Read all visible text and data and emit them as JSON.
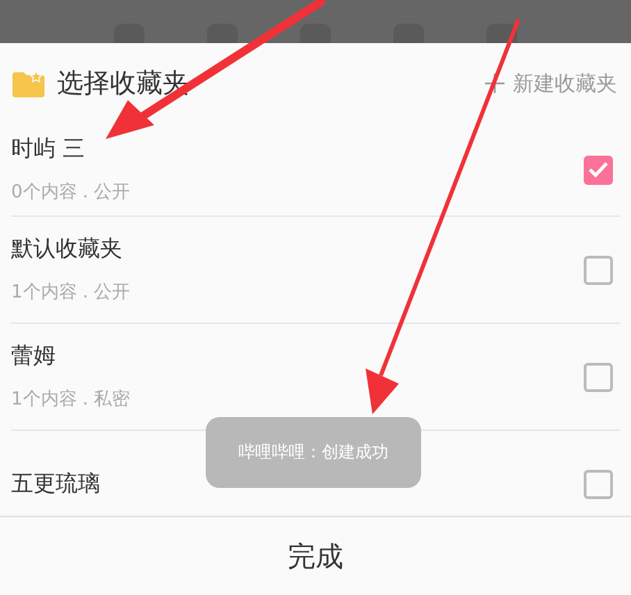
{
  "header": {
    "title": "选择收藏夹",
    "new_folder": "新建收藏夹"
  },
  "folders": [
    {
      "name": "时屿 三",
      "meta": "0个内容 . 公开",
      "checked": true
    },
    {
      "name": "默认收藏夹",
      "meta": "1个内容 . 公开",
      "checked": false
    },
    {
      "name": "蕾姆",
      "meta": "1个内容 . 私密",
      "checked": false
    },
    {
      "name": "五更琉璃",
      "checked": false
    }
  ],
  "toast": "哔哩哔哩：创建成功",
  "done_button": "完成"
}
